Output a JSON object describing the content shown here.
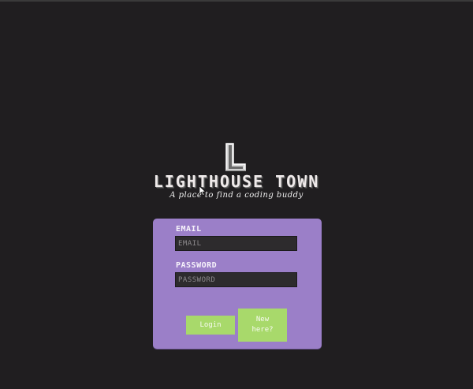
{
  "brand": {
    "logo_letter": "L",
    "title": "LIGHTHOUSE TOWN",
    "tagline": "A place to find a coding buddy"
  },
  "login_form": {
    "email_label": "EMAIL",
    "email_placeholder": "EMAIL",
    "email_value": "",
    "password_label": "PASSWORD",
    "password_placeholder": "PASSWORD",
    "password_value": "",
    "login_button": "Login",
    "new_button": "New here?"
  },
  "colors": {
    "background": "#201e20",
    "card": "#9b7fc8",
    "button": "#a8d96b",
    "input": "#2d2b2d"
  },
  "icons": {
    "logo": "lighthouse-l-logo-icon",
    "cursor": "mouse-pointer-icon"
  }
}
